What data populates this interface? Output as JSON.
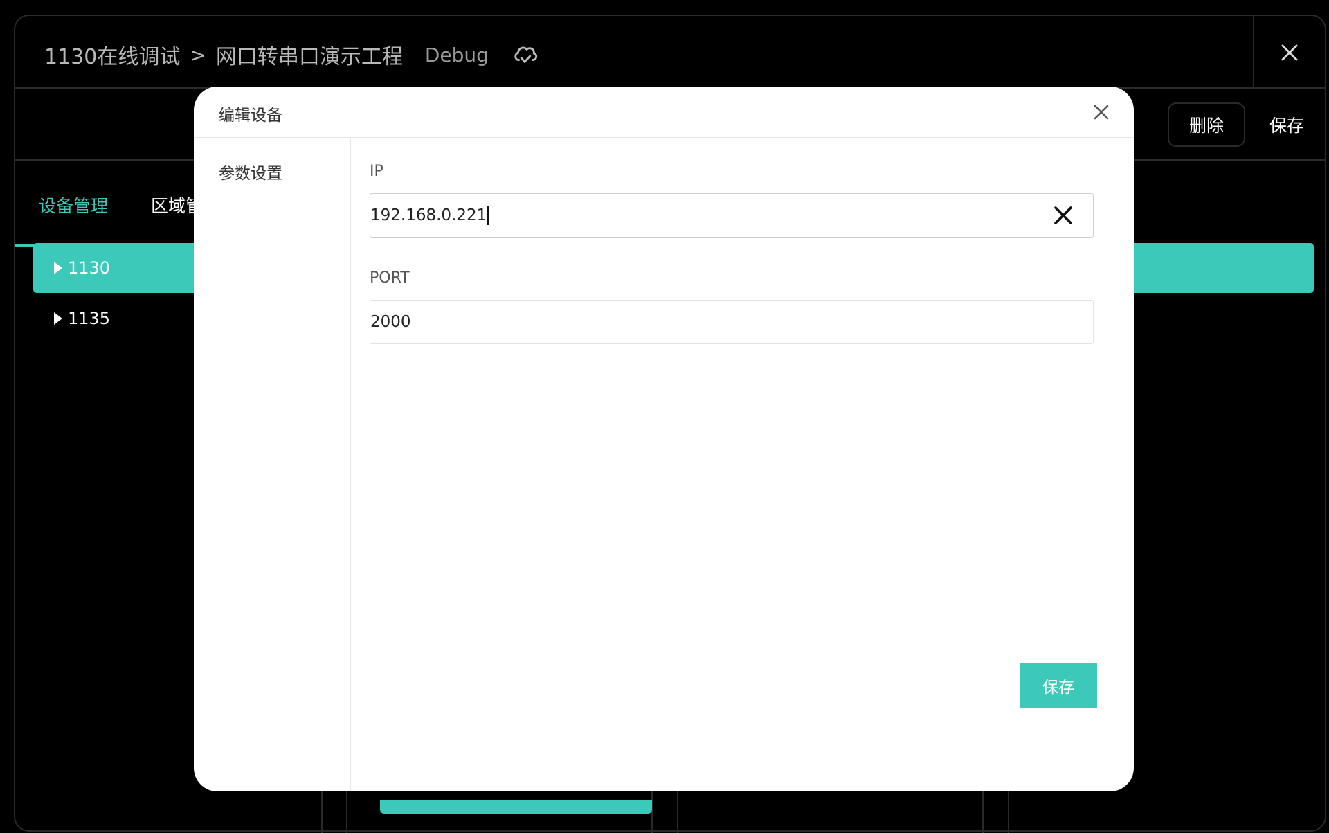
{
  "window": {
    "breadcrumb_root": "1130在线调试",
    "breadcrumb_separator": ">",
    "breadcrumb_project": "网口转串口演示工程",
    "mode": "Debug"
  },
  "toolbar": {
    "delete_label": "删除",
    "save_label": "保存"
  },
  "tabs": [
    {
      "label": "设备管理",
      "active": true
    },
    {
      "label": "区域管"
    }
  ],
  "tree": {
    "items": [
      {
        "label": "1130",
        "selected": true
      },
      {
        "label": "1135",
        "selected": false
      }
    ]
  },
  "modal": {
    "title": "编辑设备",
    "sidebar_items": [
      {
        "label": "参数设置"
      }
    ],
    "fields": {
      "ip_label": "IP",
      "ip_value": "192.168.0.221",
      "port_label": "PORT",
      "port_value": "2000"
    },
    "save_label": "保存"
  },
  "colors": {
    "accent": "#3cc9b9",
    "background": "#000000",
    "modal_background": "#ffffff"
  }
}
